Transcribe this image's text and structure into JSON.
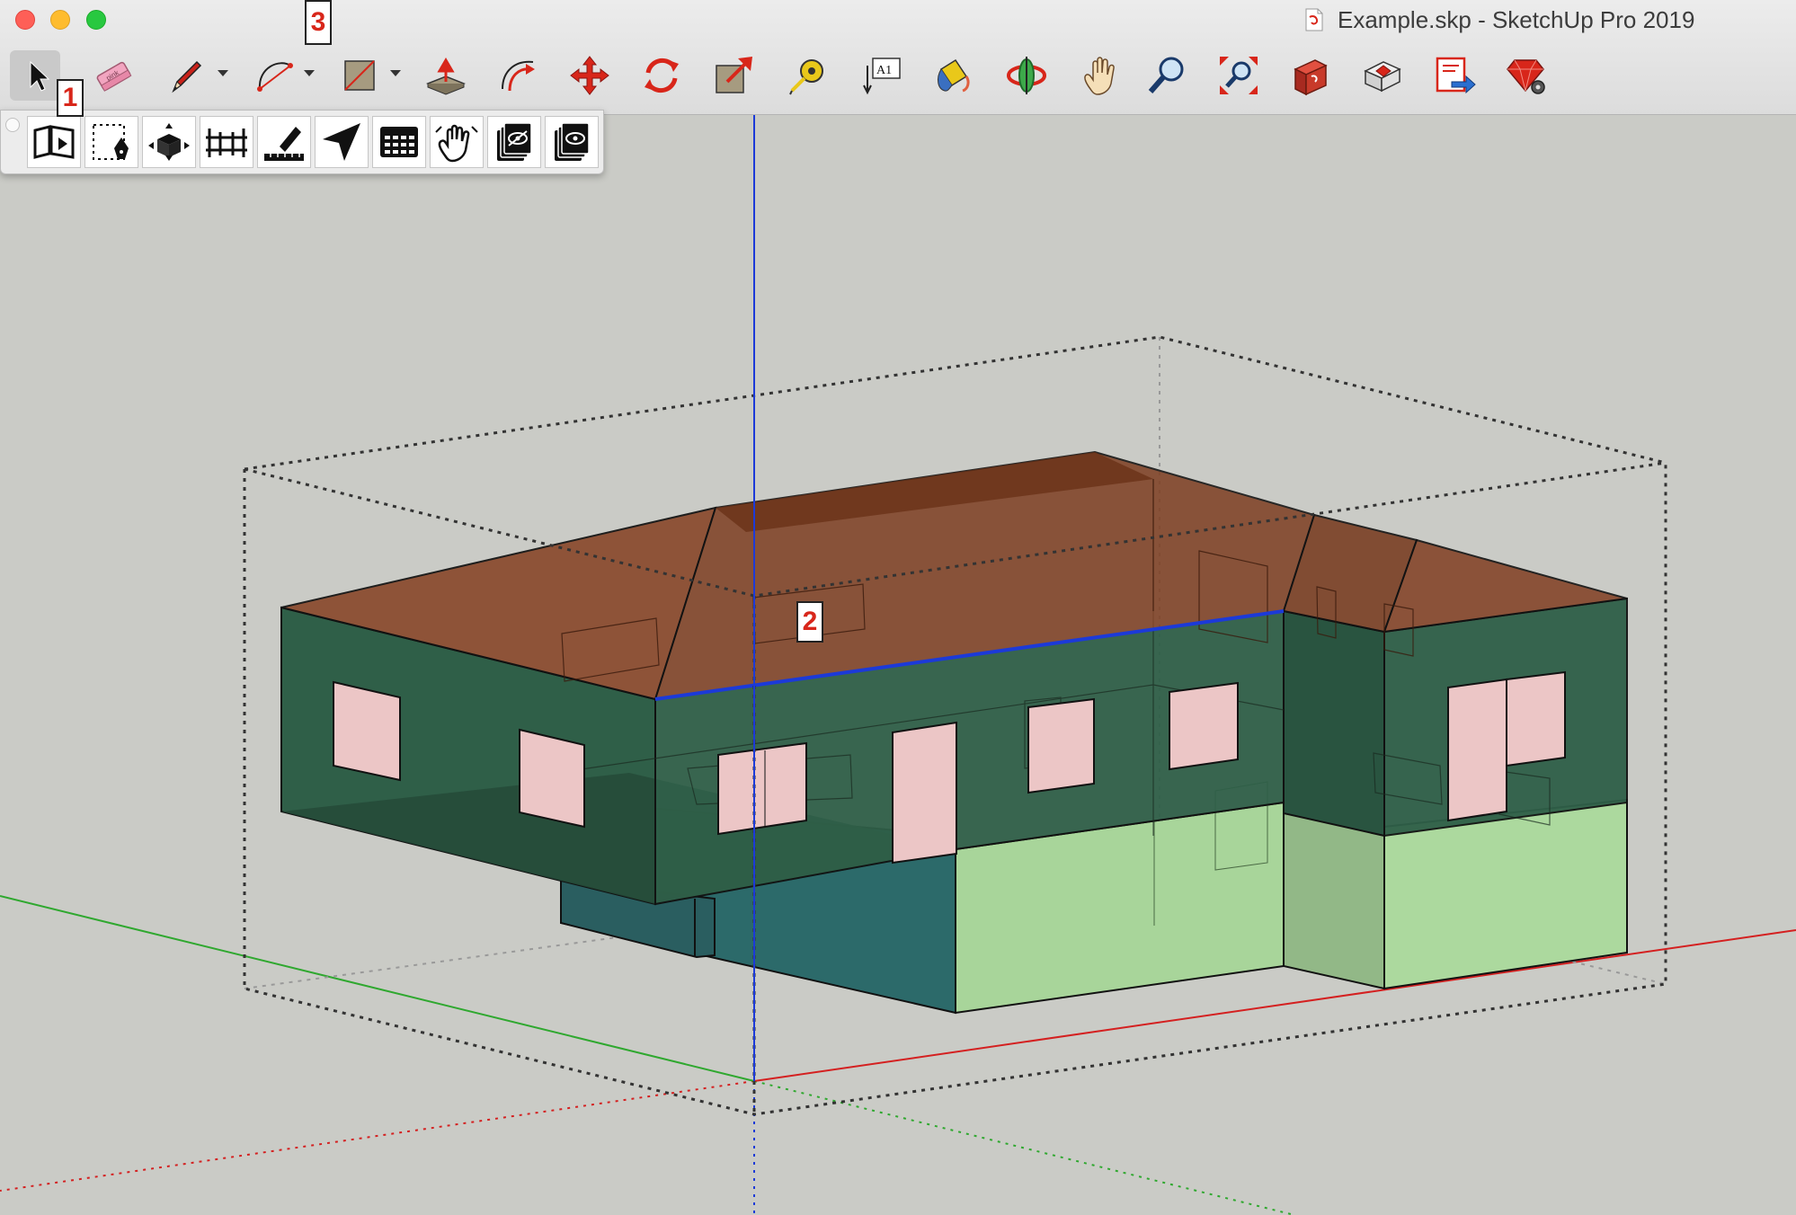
{
  "window": {
    "title": "Example.skp - SketchUp Pro 2019"
  },
  "toolbar": {
    "tools": [
      {
        "name": "select",
        "icon": "select-arrow-icon"
      },
      {
        "name": "eraser",
        "icon": "eraser-icon",
        "label": "pink"
      },
      {
        "name": "line",
        "icon": "pencil-icon"
      },
      {
        "name": "arc",
        "icon": "arc-icon"
      },
      {
        "name": "rectangle",
        "icon": "rectangle-icon"
      },
      {
        "name": "push-pull",
        "icon": "push-pull-icon"
      },
      {
        "name": "offset",
        "icon": "offset-icon"
      },
      {
        "name": "move",
        "icon": "move-icon"
      },
      {
        "name": "rotate",
        "icon": "rotate-icon"
      },
      {
        "name": "scale",
        "icon": "scale-icon"
      },
      {
        "name": "tape-measure",
        "icon": "tape-measure-icon"
      },
      {
        "name": "text",
        "icon": "text-icon",
        "label": "A1"
      },
      {
        "name": "paint-bucket",
        "icon": "paint-bucket-icon"
      },
      {
        "name": "orbit",
        "icon": "orbit-icon"
      },
      {
        "name": "pan",
        "icon": "pan-hand-icon"
      },
      {
        "name": "zoom",
        "icon": "zoom-icon"
      },
      {
        "name": "zoom-extents",
        "icon": "zoom-extents-icon"
      },
      {
        "name": "3d-warehouse",
        "icon": "3d-warehouse-icon"
      },
      {
        "name": "extension-warehouse",
        "icon": "extension-warehouse-icon"
      },
      {
        "name": "send-to-layout",
        "icon": "send-to-layout-icon"
      },
      {
        "name": "extension-manager",
        "icon": "ruby-gem-icon"
      }
    ]
  },
  "flyout": {
    "tools": [
      {
        "name": "intro-panel",
        "icon": "book-play-icon"
      },
      {
        "name": "draw-zone",
        "icon": "dashed-rect-pen-icon"
      },
      {
        "name": "zone-box",
        "icon": "box-arrows-icon"
      },
      {
        "name": "component-grid",
        "icon": "fence-grid-icon"
      },
      {
        "name": "measure-edit",
        "icon": "pencil-ruler-icon"
      },
      {
        "name": "navigate",
        "icon": "navigation-arrow-icon"
      },
      {
        "name": "spreadsheet",
        "icon": "grid-table-icon"
      },
      {
        "name": "hand-grab",
        "icon": "grab-hand-icon"
      },
      {
        "name": "hide-layers",
        "icon": "layers-hidden-icon"
      },
      {
        "name": "show-layers",
        "icon": "layers-eye-icon"
      }
    ]
  },
  "callouts": {
    "one": "1",
    "two": "2",
    "three": "3"
  },
  "colors": {
    "roof": "#7f4226",
    "walls": "#2f5f48",
    "lower_walls": "#a8d59a",
    "foundation": "#2c6a6a",
    "windows": "#ecc6c6",
    "blue_axis": "#1c3ad8",
    "red_axis": "#d42020",
    "green_axis": "#2fa82f",
    "background": "#cacbc6"
  }
}
